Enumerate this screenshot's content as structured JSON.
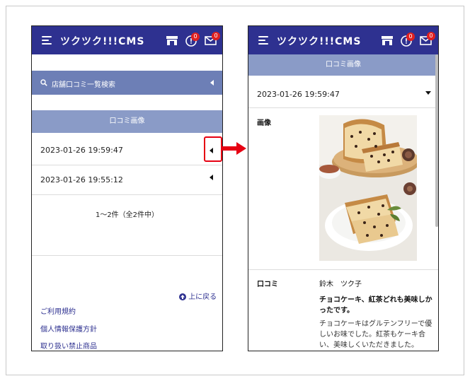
{
  "app": {
    "brand": "ツクツク!!!CMS"
  },
  "header": {
    "notification_badge": "0",
    "mail_badge": "0"
  },
  "left_screen": {
    "search_label": "店舗口コミ一覧検索",
    "section_title": "口コミ画像",
    "rows": [
      {
        "datetime": "2023-01-26 19:59:47"
      },
      {
        "datetime": "2023-01-26 19:55:12"
      }
    ],
    "pagination": "1～2件（全2件中）",
    "back_to_top": "上に戻る",
    "footer_links": [
      "ご利用規約",
      "個人情報保護方針",
      "取り扱い禁止商品"
    ]
  },
  "right_screen": {
    "section_title": "口コミ画像",
    "datetime": "2023-01-26 19:59:47",
    "image_label": "画像",
    "review_label": "口コミ",
    "reviewer_name": "鈴木　ツク子",
    "review_title_line1": "チョコケーキ、紅茶どれも美味しか",
    "review_title_line2": "ったです。",
    "review_body_line1": "チョコケーキはグルテンフリーで優",
    "review_body_line2": "しいお味でした。紅茶もケーキ合",
    "review_body_line3": "い、美味しくいただきました。"
  },
  "colors": {
    "header": "#2e3190",
    "search_bar": "#6d7fb6",
    "section_bar": "#8a9bc7",
    "highlight": "#e60012"
  }
}
